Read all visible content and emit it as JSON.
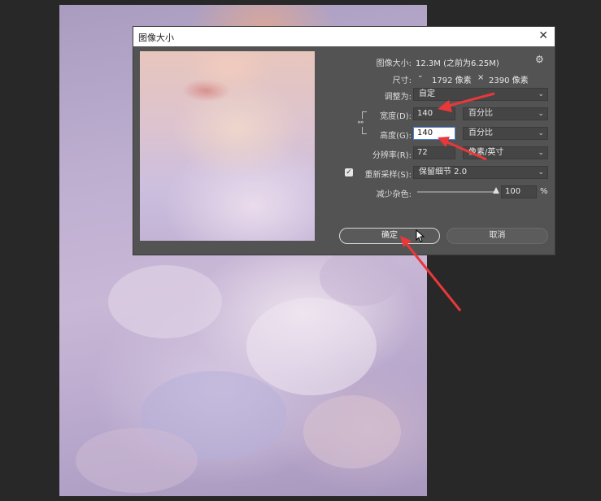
{
  "dialog": {
    "title": "图像大小",
    "close_glyph": "✕",
    "image_size_label": "图像大小:",
    "image_size_value": "12.3M (之前为6.25M)",
    "dimensions_label": "尺寸:",
    "dimensions_w": "1792 像素",
    "dimensions_x": "×",
    "dimensions_h": "2390 像素",
    "fit_to_label": "调整为:",
    "fit_to_value": "自定",
    "width_label": "宽度(D):",
    "width_value": "140",
    "width_unit": "百分比",
    "height_label": "高度(G):",
    "height_value": "140",
    "height_unit": "百分比",
    "resolution_label": "分辨率(R):",
    "resolution_value": "72",
    "resolution_unit": "像素/英寸",
    "resample_label": "重新采样(S):",
    "resample_value": "保留细节 2.0",
    "reduce_noise_label": "减少杂色:",
    "reduce_noise_value": "100",
    "reduce_noise_unit": "%",
    "ok_label": "确定",
    "cancel_label": "取消"
  },
  "icons": {
    "settings": "gear-icon",
    "dimension_toggle": "chevron-down-icon",
    "link": "chain-link-icon",
    "close": "close-icon",
    "cursor": "pointer-cursor-icon",
    "chevron": "chevron-down-icon",
    "checkbox": "checkbox-checked-icon"
  },
  "colors": {
    "annotation_arrow": "#e8383a",
    "dialog_bg": "#535353",
    "workspace_bg": "#282828"
  },
  "state": {
    "resample_checked": true,
    "reduce_noise_percent": 100
  }
}
